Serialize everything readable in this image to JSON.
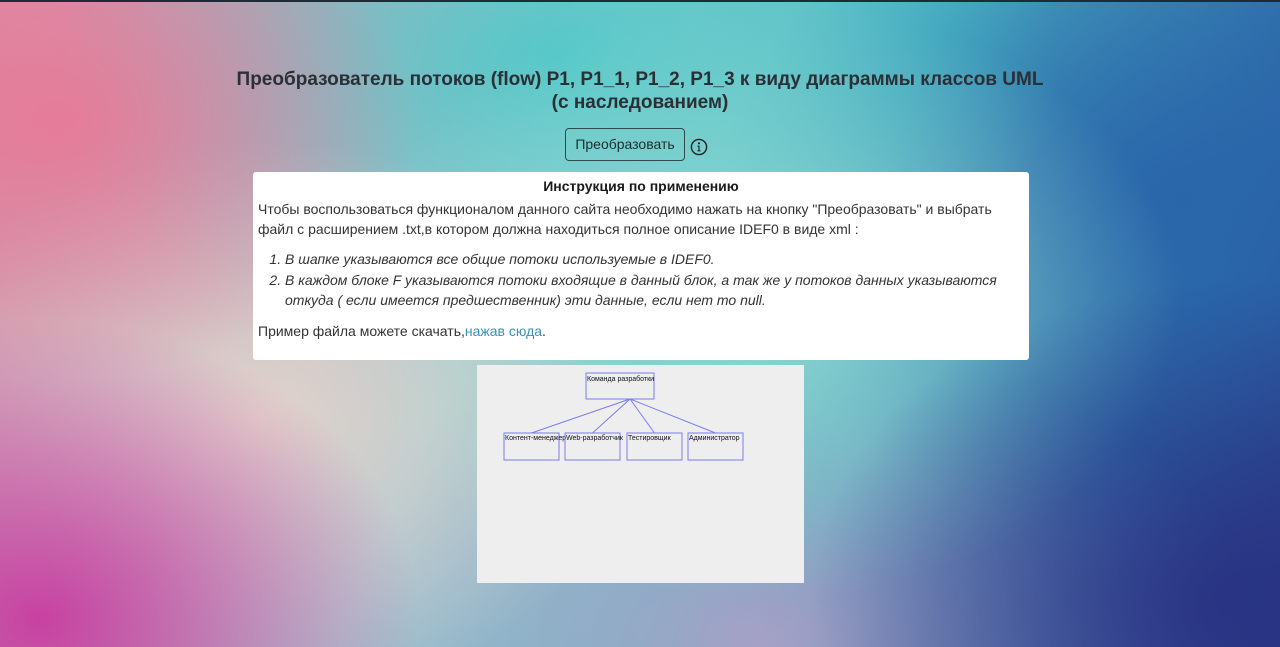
{
  "page": {
    "title": "Преобразователь потоков (flow) P1, P1_1, P1_2, P1_3 к виду диаграммы классов UML (с наследованием)",
    "convert_button": "Преобразовать",
    "info_icon": "info-circle-icon"
  },
  "instructions": {
    "heading": "Инструкция по применению",
    "intro": "Чтобы воспользоваться функционалом данного сайта необходимо нажать на кнопку \"Преобразовать\" и выбрать файл с расширением .txt,в котором должна находиться полное описание IDEF0 в виде xml :",
    "items": [
      "В шапке указываются все общие потоки используемые в IDEF0.",
      "В каждом блоке F указываются потоки входящие в данный блок, а так же у потоков данных указываются откуда ( если имеется предшественник) эти данные, если нет то null."
    ],
    "example_prefix": "Пример файла можете скачать,",
    "example_link": "нажав сюда",
    "example_suffix": "."
  },
  "diagram": {
    "parent": "Команда разработки",
    "children": [
      "Контент-менеджер",
      "Web-разработчик",
      "Тестировщик",
      "Администратор"
    ],
    "line_color": "#7b7bf0"
  }
}
